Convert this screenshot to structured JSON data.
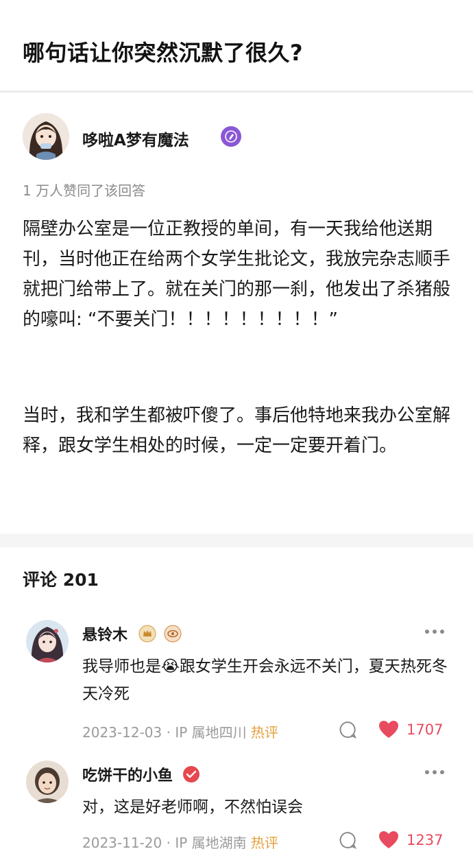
{
  "question": {
    "title": "哪句话让你突然沉默了很久?"
  },
  "author": {
    "name": "哆啦A梦有魔法",
    "badge_icon": "pen-badge-icon"
  },
  "answer": {
    "likes_note": "1 万人赞同了该回答",
    "paragraphs": [
      "隔壁办公室是一位正教授的单间，有一天我给他送期刊，当时他正在给两个女学生批论文，我放完杂志顺手就把门给带上了。就在关门的那一刹，他发出了杀猪般的嚎叫: “不要关门！！！！！！！！！”",
      "当时，我和学生都被吓傻了。事后他特地来我办公室解释，跟女学生相处的时候，一定一定要开着门。"
    ]
  },
  "comments_section": {
    "title": "评论 201",
    "comments": [
      {
        "name": "悬铃木",
        "text_before_emoji": "我导师也是",
        "emoji": "😭",
        "text_after_emoji": "跟女学生开会永远不关门，夏天热死冬天冷死",
        "date": "2023-12-03",
        "separator": " · ",
        "ip": "IP 属地四川",
        "hot_tag": "热评",
        "likes": "1707"
      },
      {
        "name": "吃饼干的小鱼",
        "text": "对，这是好老师啊，不然怕误会",
        "date": "2023-11-20",
        "separator": " · ",
        "ip": "IP 属地湖南",
        "hot_tag": "热评",
        "likes": "1237"
      }
    ]
  },
  "colors": {
    "accent_red": "#e84a5f",
    "hot_tag": "#e4a03c",
    "badge_purple": "#8a57d6",
    "verified_red": "#e5484d"
  }
}
